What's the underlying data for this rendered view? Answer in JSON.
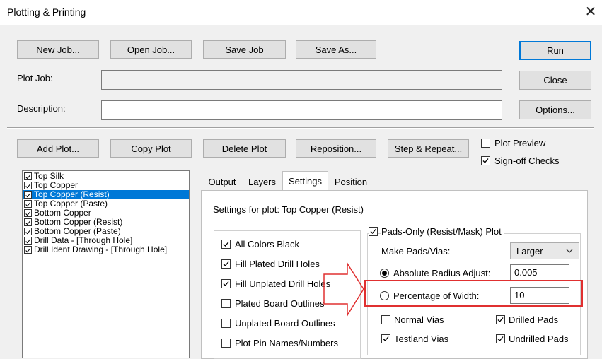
{
  "window": {
    "title": "Plotting & Printing",
    "close_symbol": "✕"
  },
  "toolbar": {
    "new_job": "New Job...",
    "open_job": "Open Job...",
    "save_job": "Save Job",
    "save_as": "Save As...",
    "run": "Run",
    "close": "Close",
    "options": "Options..."
  },
  "fields": {
    "plot_job_label": "Plot Job:",
    "plot_job_value": "",
    "description_label": "Description:",
    "description_value": ""
  },
  "plot_buttons": {
    "add_plot": "Add Plot...",
    "copy_plot": "Copy Plot",
    "delete_plot": "Delete Plot",
    "reposition": "Reposition...",
    "step_repeat": "Step & Repeat..."
  },
  "options_checks": {
    "plot_preview": {
      "label": "Plot Preview",
      "checked": false
    },
    "signoff_checks": {
      "label": "Sign-off Checks",
      "checked": true
    }
  },
  "plot_list": [
    {
      "label": "Top Silk",
      "checked": true,
      "selected": false
    },
    {
      "label": "Top Copper",
      "checked": true,
      "selected": false
    },
    {
      "label": "Top Copper (Resist)",
      "checked": true,
      "selected": true
    },
    {
      "label": "Top Copper (Paste)",
      "checked": true,
      "selected": false
    },
    {
      "label": "Bottom Copper",
      "checked": true,
      "selected": false
    },
    {
      "label": "Bottom Copper (Resist)",
      "checked": true,
      "selected": false
    },
    {
      "label": "Bottom Copper (Paste)",
      "checked": true,
      "selected": false
    },
    {
      "label": "Drill Data - [Through Hole]",
      "checked": true,
      "selected": false
    },
    {
      "label": "Drill Ident Drawing - [Through Hole]",
      "checked": true,
      "selected": false
    }
  ],
  "tabs": [
    {
      "label": "Output",
      "active": false
    },
    {
      "label": "Layers",
      "active": false
    },
    {
      "label": "Settings",
      "active": true
    },
    {
      "label": "Position",
      "active": false
    }
  ],
  "settings": {
    "header": "Settings for plot: Top Copper (Resist)",
    "general": [
      {
        "label": "All Colors Black",
        "checked": true
      },
      {
        "label": "Fill Plated Drill Holes",
        "checked": true
      },
      {
        "label": "Fill Unplated Drill Holes",
        "checked": true
      },
      {
        "label": "Plated Board Outlines",
        "checked": false
      },
      {
        "label": "Unplated Board Outlines",
        "checked": false
      },
      {
        "label": "Plot Pin Names/Numbers",
        "checked": false
      }
    ],
    "pads_only": {
      "label": "Pads-Only (Resist/Mask) Plot",
      "checked": true,
      "make_pads_label": "Make Pads/Vias:",
      "make_pads_value": "Larger",
      "absolute_label": "Absolute Radius Adjust:",
      "absolute_value": "0.005",
      "absolute_selected": true,
      "percentage_label": "Percentage of Width:",
      "percentage_value": "10",
      "percentage_selected": false,
      "normal_vias": {
        "label": "Normal Vias",
        "checked": false
      },
      "drilled_pads": {
        "label": "Drilled Pads",
        "checked": true
      },
      "testland_vias": {
        "label": "Testland Vias",
        "checked": true
      },
      "undrilled_pads": {
        "label": "Undrilled Pads",
        "checked": true
      }
    }
  },
  "annotation": {
    "highlight_color": "#e03030",
    "arrow_color": "#e03030"
  }
}
